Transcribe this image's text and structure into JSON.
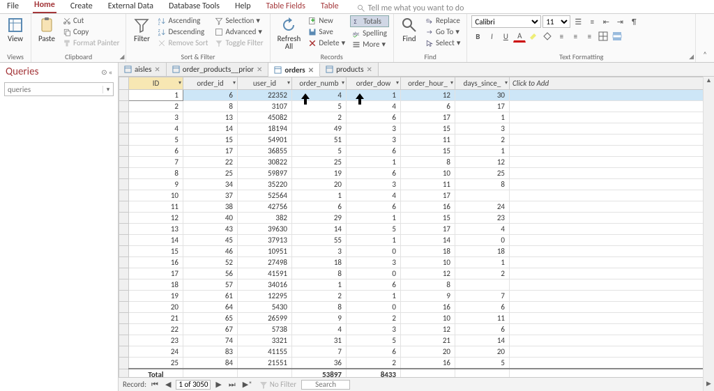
{
  "menu": {
    "tabs": [
      "File",
      "Home",
      "Create",
      "External Data",
      "Database Tools",
      "Help",
      "Table Fields",
      "Table"
    ],
    "active": "Home",
    "contextual": [
      "Table Fields",
      "Table"
    ],
    "tellme": "Tell me what you want to do"
  },
  "ribbon": {
    "views": {
      "label": "Views",
      "btn": "View"
    },
    "clipboard": {
      "label": "Clipboard",
      "paste": "Paste",
      "cut": "Cut",
      "copy": "Copy",
      "painter": "Format Painter"
    },
    "sortfilter": {
      "label": "Sort & Filter",
      "filter": "Filter",
      "asc": "Ascending",
      "desc": "Descending",
      "remove": "Remove Sort",
      "selection": "Selection",
      "advanced": "Advanced",
      "toggle": "Toggle Filter"
    },
    "records": {
      "label": "Records",
      "refresh": "Refresh\nAll",
      "new": "New",
      "save": "Save",
      "delete": "Delete",
      "totals": "Totals",
      "spelling": "Spelling",
      "more": "More"
    },
    "find": {
      "label": "Find",
      "find": "Find",
      "replace": "Replace",
      "goto": "Go To",
      "select": "Select"
    },
    "textfmt": {
      "label": "Text Formatting",
      "font": "Calibri",
      "size": "11"
    }
  },
  "nav": {
    "header": "Queries",
    "search_placeholder": "queries"
  },
  "doctabs": [
    {
      "label": "aisles",
      "active": false
    },
    {
      "label": "order_products__prior",
      "active": false
    },
    {
      "label": "orders",
      "active": true
    },
    {
      "label": "products",
      "active": false
    }
  ],
  "grid": {
    "columns": [
      "ID",
      "order_id",
      "user_id",
      "order_numb",
      "order_dow",
      "order_hour_",
      "days_since_"
    ],
    "addcol": "Click to Add",
    "rows": [
      [
        1,
        6,
        22352,
        4,
        1,
        12,
        30
      ],
      [
        2,
        8,
        3107,
        5,
        4,
        6,
        17
      ],
      [
        3,
        13,
        45082,
        2,
        6,
        17,
        1
      ],
      [
        4,
        14,
        18194,
        49,
        3,
        15,
        3
      ],
      [
        5,
        15,
        54901,
        51,
        3,
        11,
        2
      ],
      [
        6,
        17,
        36855,
        5,
        6,
        15,
        1
      ],
      [
        7,
        22,
        30822,
        25,
        1,
        8,
        12
      ],
      [
        8,
        25,
        59897,
        19,
        6,
        10,
        25
      ],
      [
        9,
        34,
        35220,
        20,
        3,
        11,
        8
      ],
      [
        10,
        37,
        52564,
        1,
        4,
        17,
        ""
      ],
      [
        11,
        38,
        42756,
        6,
        6,
        16,
        24
      ],
      [
        12,
        40,
        382,
        29,
        1,
        15,
        23
      ],
      [
        13,
        43,
        39630,
        14,
        5,
        17,
        4
      ],
      [
        14,
        45,
        37913,
        55,
        1,
        14,
        0
      ],
      [
        15,
        46,
        10951,
        3,
        0,
        18,
        18
      ],
      [
        16,
        52,
        27498,
        18,
        3,
        10,
        1
      ],
      [
        17,
        56,
        41591,
        8,
        0,
        12,
        2
      ],
      [
        18,
        57,
        34016,
        1,
        6,
        8,
        ""
      ],
      [
        19,
        61,
        12295,
        2,
        1,
        9,
        7
      ],
      [
        20,
        64,
        5430,
        8,
        0,
        16,
        6
      ],
      [
        21,
        65,
        26599,
        9,
        2,
        10,
        11
      ],
      [
        22,
        67,
        5738,
        4,
        3,
        12,
        6
      ],
      [
        23,
        74,
        3321,
        31,
        5,
        21,
        14
      ],
      [
        24,
        83,
        41155,
        7,
        6,
        20,
        20
      ],
      [
        25,
        84,
        21551,
        36,
        2,
        16,
        5
      ]
    ],
    "totals": {
      "label": "Total",
      "order_numb": 53897,
      "order_dow": 8433
    }
  },
  "recordnav": {
    "label": "Record:",
    "pos": "1 of 3050",
    "nofilter": "No Filter",
    "search": "Search"
  }
}
